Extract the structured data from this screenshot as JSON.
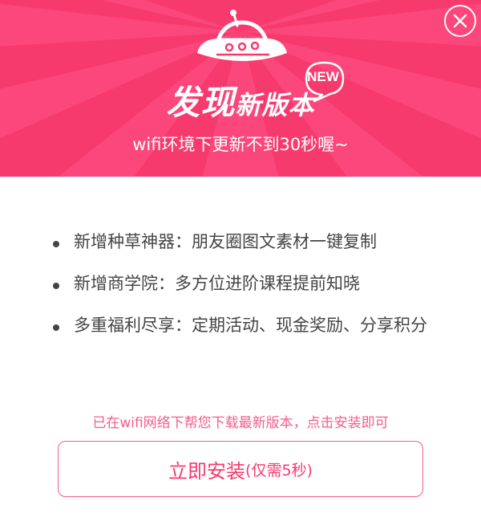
{
  "dialog": {
    "title_main": "发现",
    "title_sub": "新版本",
    "badge": "NEW",
    "subtitle": "wifi环境下更新不到30秒喔~",
    "close_icon": "close-icon",
    "illustration_icon": "ufo-icon",
    "accent_color": "#f73a6e",
    "features": [
      "新增种草神器：朋友圈图文素材一键复制",
      "新增商学院：多方位进阶课程提前知晓",
      "多重福利尽享：定期活动、现金奖励、分享积分"
    ],
    "notice": "已在wifi网络下帮您下载最新版本，点击安装即可",
    "install_label": "立即安装",
    "install_note": "(仅需5秒)"
  }
}
